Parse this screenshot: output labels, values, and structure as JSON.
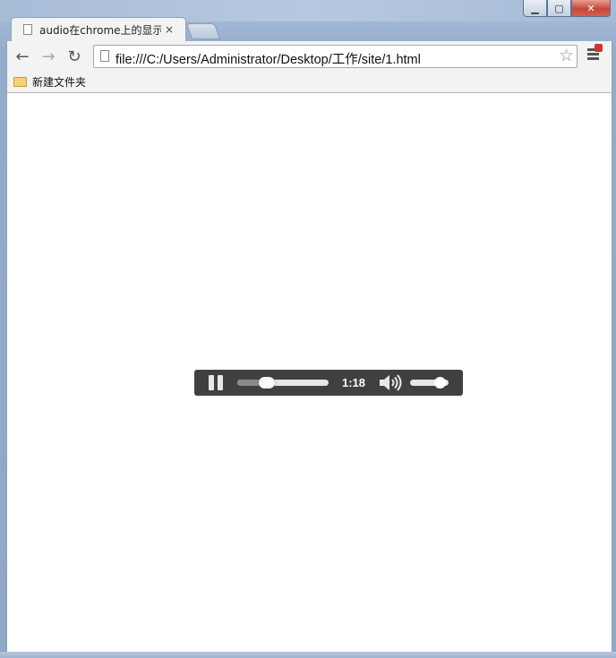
{
  "window": {
    "minimize_label": "▁",
    "maximize_label": "▢",
    "close_label": "✕"
  },
  "tab": {
    "title": "audio在chrome上的显示",
    "close_label": "×"
  },
  "toolbar": {
    "back_label": "←",
    "forward_label": "→",
    "reload_label": "↻",
    "url": "file:///C:/Users/Administrator/Desktop/工作/site/1.html",
    "star_label": "☆"
  },
  "bookmarks": {
    "items": [
      {
        "label": "新建文件夹",
        "icon": "folder-icon"
      }
    ]
  },
  "audio_player": {
    "state": "playing",
    "pause_icon": "pause-icon",
    "time": "1:18",
    "progress": 0.29,
    "volume": 0.9,
    "volume_icon": "speaker-icon",
    "background_color": "#404040"
  }
}
